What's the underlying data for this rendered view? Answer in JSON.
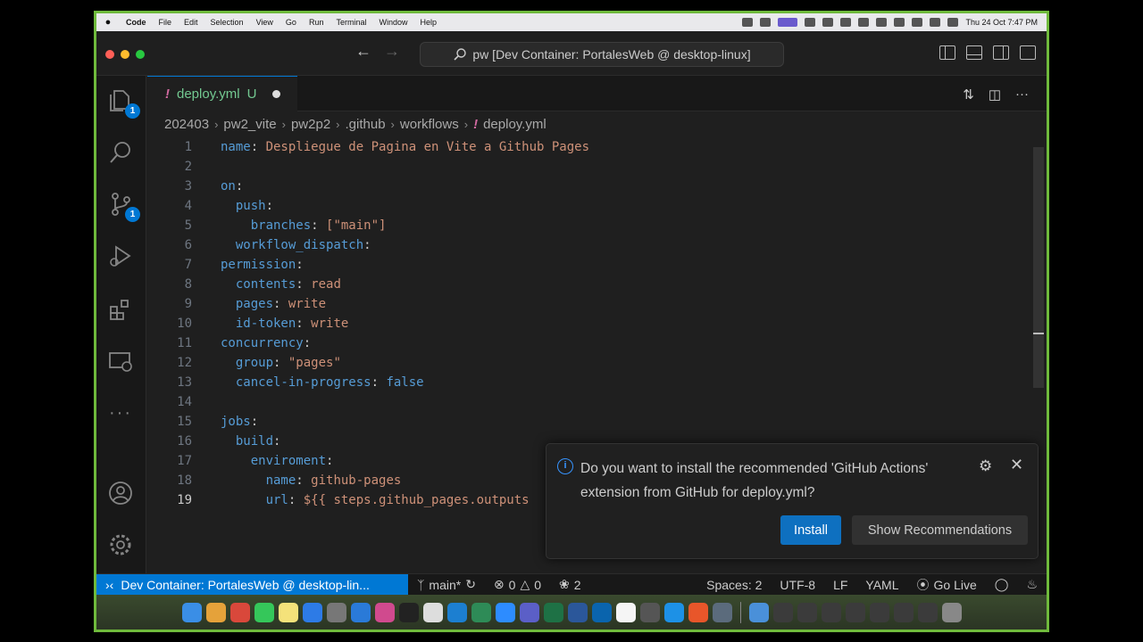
{
  "menubar": {
    "apple": "",
    "items": [
      "Code",
      "File",
      "Edit",
      "Selection",
      "View",
      "Go",
      "Run",
      "Terminal",
      "Window",
      "Help"
    ],
    "clock": "Thu 24 Oct  7:47 PM"
  },
  "titlebar": {
    "command_center": "pw [Dev Container: PortalesWeb @ desktop-linux]"
  },
  "activity": {
    "explorer_badge": "1",
    "scm_badge": "1"
  },
  "tab": {
    "filename": "deploy.yml",
    "status": "U",
    "icon": "!"
  },
  "breadcrumb": {
    "parts": [
      "202403",
      "pw2_vite",
      "pw2p2",
      ".github",
      "workflows",
      "deploy.yml"
    ],
    "icon": "!"
  },
  "code": {
    "line_numbers": [
      "1",
      "2",
      "3",
      "4",
      "5",
      "6",
      "7",
      "8",
      "9",
      "10",
      "11",
      "12",
      "13",
      "14",
      "15",
      "16",
      "17",
      "18",
      "19"
    ],
    "lines": [
      {
        "indent": "",
        "key": "name",
        "sep": ": ",
        "val": "Despliegue de Pagina en Vite a Github Pages"
      },
      {
        "indent": "",
        "key": "",
        "sep": "",
        "val": ""
      },
      {
        "indent": "",
        "key": "on",
        "sep": ":",
        "val": ""
      },
      {
        "indent": "  ",
        "key": "push",
        "sep": ":",
        "val": ""
      },
      {
        "indent": "    ",
        "key": "branches",
        "sep": ": ",
        "val": "[\"main\"]"
      },
      {
        "indent": "  ",
        "key": "workflow_dispatch",
        "sep": ":",
        "val": ""
      },
      {
        "indent": "",
        "key": "permission",
        "sep": ":",
        "val": ""
      },
      {
        "indent": "  ",
        "key": "contents",
        "sep": ": ",
        "val": "read"
      },
      {
        "indent": "  ",
        "key": "pages",
        "sep": ": ",
        "val": "write"
      },
      {
        "indent": "  ",
        "key": "id-token",
        "sep": ": ",
        "val": "write"
      },
      {
        "indent": "",
        "key": "concurrency",
        "sep": ":",
        "val": ""
      },
      {
        "indent": "  ",
        "key": "group",
        "sep": ": ",
        "val": "\"pages\""
      },
      {
        "indent": "  ",
        "key": "cancel-in-progress",
        "sep": ": ",
        "val": "false"
      },
      {
        "indent": "",
        "key": "",
        "sep": "",
        "val": ""
      },
      {
        "indent": "",
        "key": "jobs",
        "sep": ":",
        "val": ""
      },
      {
        "indent": "  ",
        "key": "build",
        "sep": ":",
        "val": ""
      },
      {
        "indent": "    ",
        "key": "enviroment",
        "sep": ":",
        "val": ""
      },
      {
        "indent": "      ",
        "key": "name",
        "sep": ": ",
        "val": "github-pages"
      },
      {
        "indent": "      ",
        "key": "url",
        "sep": ": ",
        "val": "${{ steps.github_pages.outputs"
      }
    ]
  },
  "notification": {
    "message": "Do you want to install the recommended 'GitHub Actions' extension from GitHub for deploy.yml?",
    "install_label": "Install",
    "recommendations_label": "Show Recommendations"
  },
  "statusbar": {
    "remote": "Dev Container: PortalesWeb @ desktop-lin...",
    "branch": "main*",
    "errors": "0",
    "warnings": "0",
    "ports": "2",
    "spaces": "Spaces: 2",
    "encoding": "UTF-8",
    "eol": "LF",
    "language": "YAML",
    "golive": "Go Live"
  },
  "colors": {
    "accent": "#0078d4",
    "key": "#569cd6",
    "string": "#ce9178",
    "untracked": "#73c991"
  }
}
